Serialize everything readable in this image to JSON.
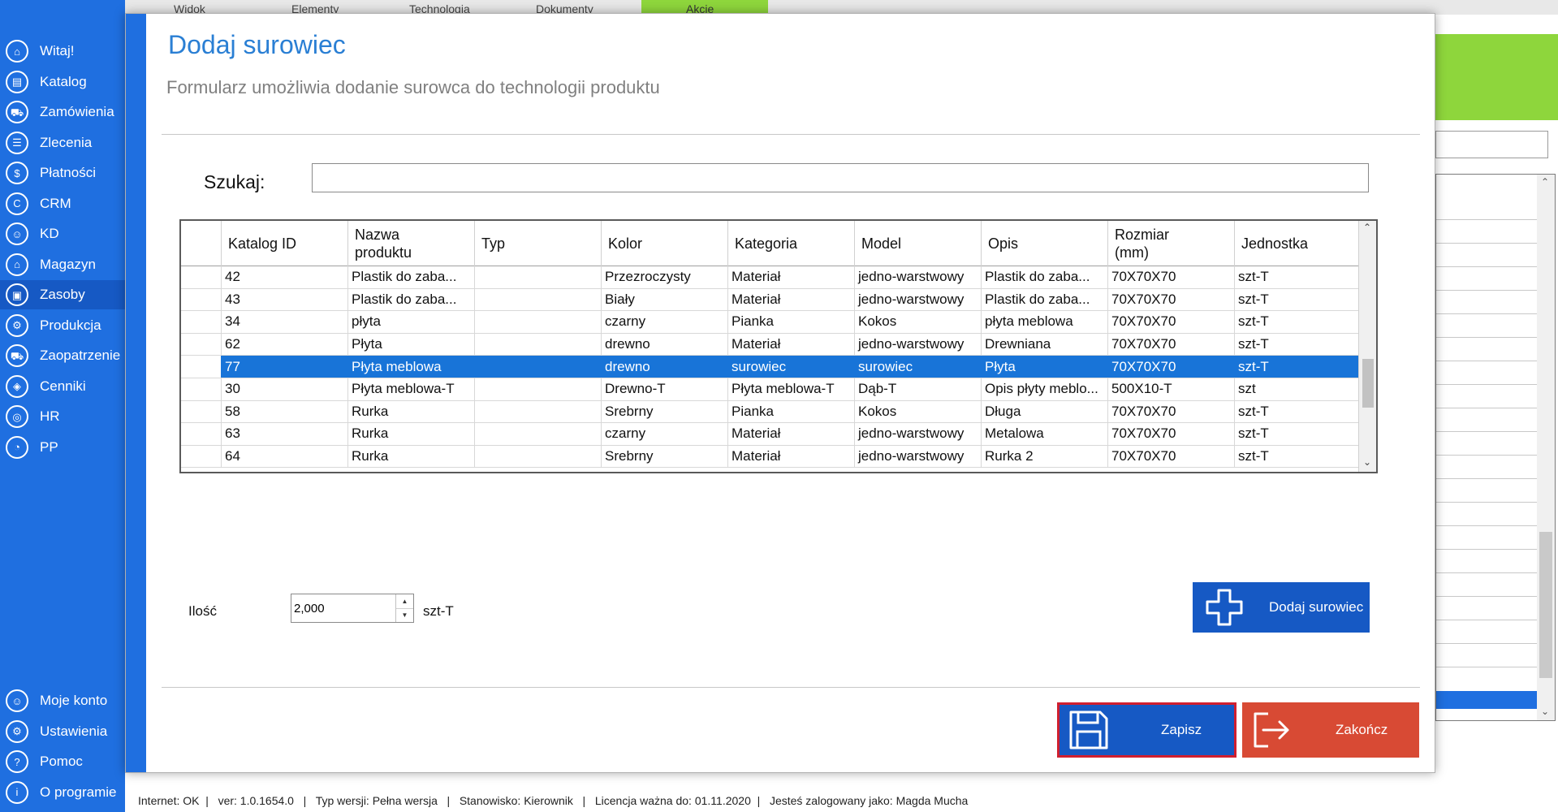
{
  "background": {
    "tabs": [
      "Widok",
      "Elementy",
      "Technologia",
      "Dokumenty",
      "Akcje"
    ]
  },
  "sidebar": {
    "items": [
      {
        "label": "Witaj!",
        "icon": "home-icon",
        "glyph": "⌂"
      },
      {
        "label": "Katalog",
        "icon": "book-icon",
        "glyph": "▤"
      },
      {
        "label": "Zamówienia",
        "icon": "cart-icon",
        "glyph": "⛟"
      },
      {
        "label": "Zlecenia",
        "icon": "list-icon",
        "glyph": "☰"
      },
      {
        "label": "Płatności",
        "icon": "dollar-icon",
        "glyph": "$"
      },
      {
        "label": "CRM",
        "icon": "crm-icon",
        "glyph": "C"
      },
      {
        "label": "KD",
        "icon": "person-icon",
        "glyph": "☺"
      },
      {
        "label": "Magazyn",
        "icon": "warehouse-icon",
        "glyph": "⌂"
      },
      {
        "label": "Zasoby",
        "icon": "box-icon",
        "glyph": "▣"
      },
      {
        "label": "Produkcja",
        "icon": "production-icon",
        "glyph": "⚙"
      },
      {
        "label": "Zaopatrzenie",
        "icon": "truck-icon",
        "glyph": "⛟"
      },
      {
        "label": "Cenniki",
        "icon": "tag-icon",
        "glyph": "◈"
      },
      {
        "label": "HR",
        "icon": "fingerprint-icon",
        "glyph": "◎"
      },
      {
        "label": "PP",
        "icon": "chart-icon",
        "glyph": "◔"
      }
    ],
    "bottom_items": [
      {
        "label": "Moje konto",
        "icon": "account-icon",
        "glyph": "☺"
      },
      {
        "label": "Ustawienia",
        "icon": "settings-icon",
        "glyph": "⚙"
      },
      {
        "label": "Pomoc",
        "icon": "help-icon",
        "glyph": "?"
      },
      {
        "label": "O programie",
        "icon": "info-icon",
        "glyph": "i"
      }
    ],
    "active": "Zasoby"
  },
  "dialog": {
    "title": "Dodaj surowiec",
    "subtitle": "Formularz umożliwia dodanie surowca do technologii produktu",
    "search": {
      "label": "Szukaj:",
      "value": "",
      "placeholder": ""
    },
    "grid": {
      "columns": [
        "Katalog ID",
        "Nazwa\nproduktu",
        "Typ",
        "Kolor",
        "Kategoria",
        "Model",
        "Opis",
        "Rozmiar\n(mm)",
        "Jednostka"
      ],
      "rows": [
        [
          "42",
          "Plastik do zaba...",
          "",
          "Przezroczysty",
          "Materiał",
          "jedno-warstwowy",
          "Plastik do zaba...",
          "70X70X70",
          "szt-T"
        ],
        [
          "43",
          "Plastik do zaba...",
          "",
          "Biały",
          "Materiał",
          "jedno-warstwowy",
          "Plastik do zaba...",
          "70X70X70",
          "szt-T"
        ],
        [
          "34",
          "płyta",
          "",
          "czarny",
          "Pianka",
          "Kokos",
          "płyta meblowa",
          "70X70X70",
          "szt-T"
        ],
        [
          "62",
          "Płyta",
          "",
          "drewno",
          "Materiał",
          "jedno-warstwowy",
          "Drewniana",
          "70X70X70",
          "szt-T"
        ],
        [
          "77",
          "Płyta meblowa",
          "",
          "drewno",
          "surowiec",
          "surowiec",
          "Płyta",
          "70X70X70",
          "szt-T"
        ],
        [
          "30",
          "Płyta meblowa-T",
          "",
          "Drewno-T",
          "Płyta meblowa-T",
          "Dąb-T",
          "Opis płyty meblo...",
          "500X10-T",
          "szt"
        ],
        [
          "58",
          "Rurka",
          "",
          "Srebrny",
          "Pianka",
          "Kokos",
          "Długa",
          "70X70X70",
          "szt-T"
        ],
        [
          "63",
          "Rurka",
          "",
          "czarny",
          "Materiał",
          "jedno-warstwowy",
          "Metalowa",
          "70X70X70",
          "szt-T"
        ],
        [
          "64",
          "Rurka",
          "",
          "Srebrny",
          "Materiał",
          "jedno-warstwowy",
          "Rurka 2",
          "70X70X70",
          "szt-T"
        ]
      ],
      "selected_index": 4
    },
    "quantity": {
      "label": "Ilość",
      "value": "2,000",
      "unit": "szt-T"
    },
    "add_button": "Dodaj surowiec",
    "save_button": "Zapisz",
    "close_button": "Zakończ"
  },
  "statusbar": {
    "text": "Internet: OK  |   ver: 1.0.1654.0   |   Typ wersji: Pełna wersja   |   Stanowisko: Kierownik   |   Licencja ważna do: 01.11.2020  |   Jesteś zalogowany jako: Magda Mucha"
  },
  "colors": {
    "sidebar": "#1f6fe0",
    "accent_green": "#8ed63c",
    "title_blue": "#2a7fd4",
    "selection": "#1874d8",
    "save_border": "#d01f2f",
    "close_button": "#d84a34"
  }
}
